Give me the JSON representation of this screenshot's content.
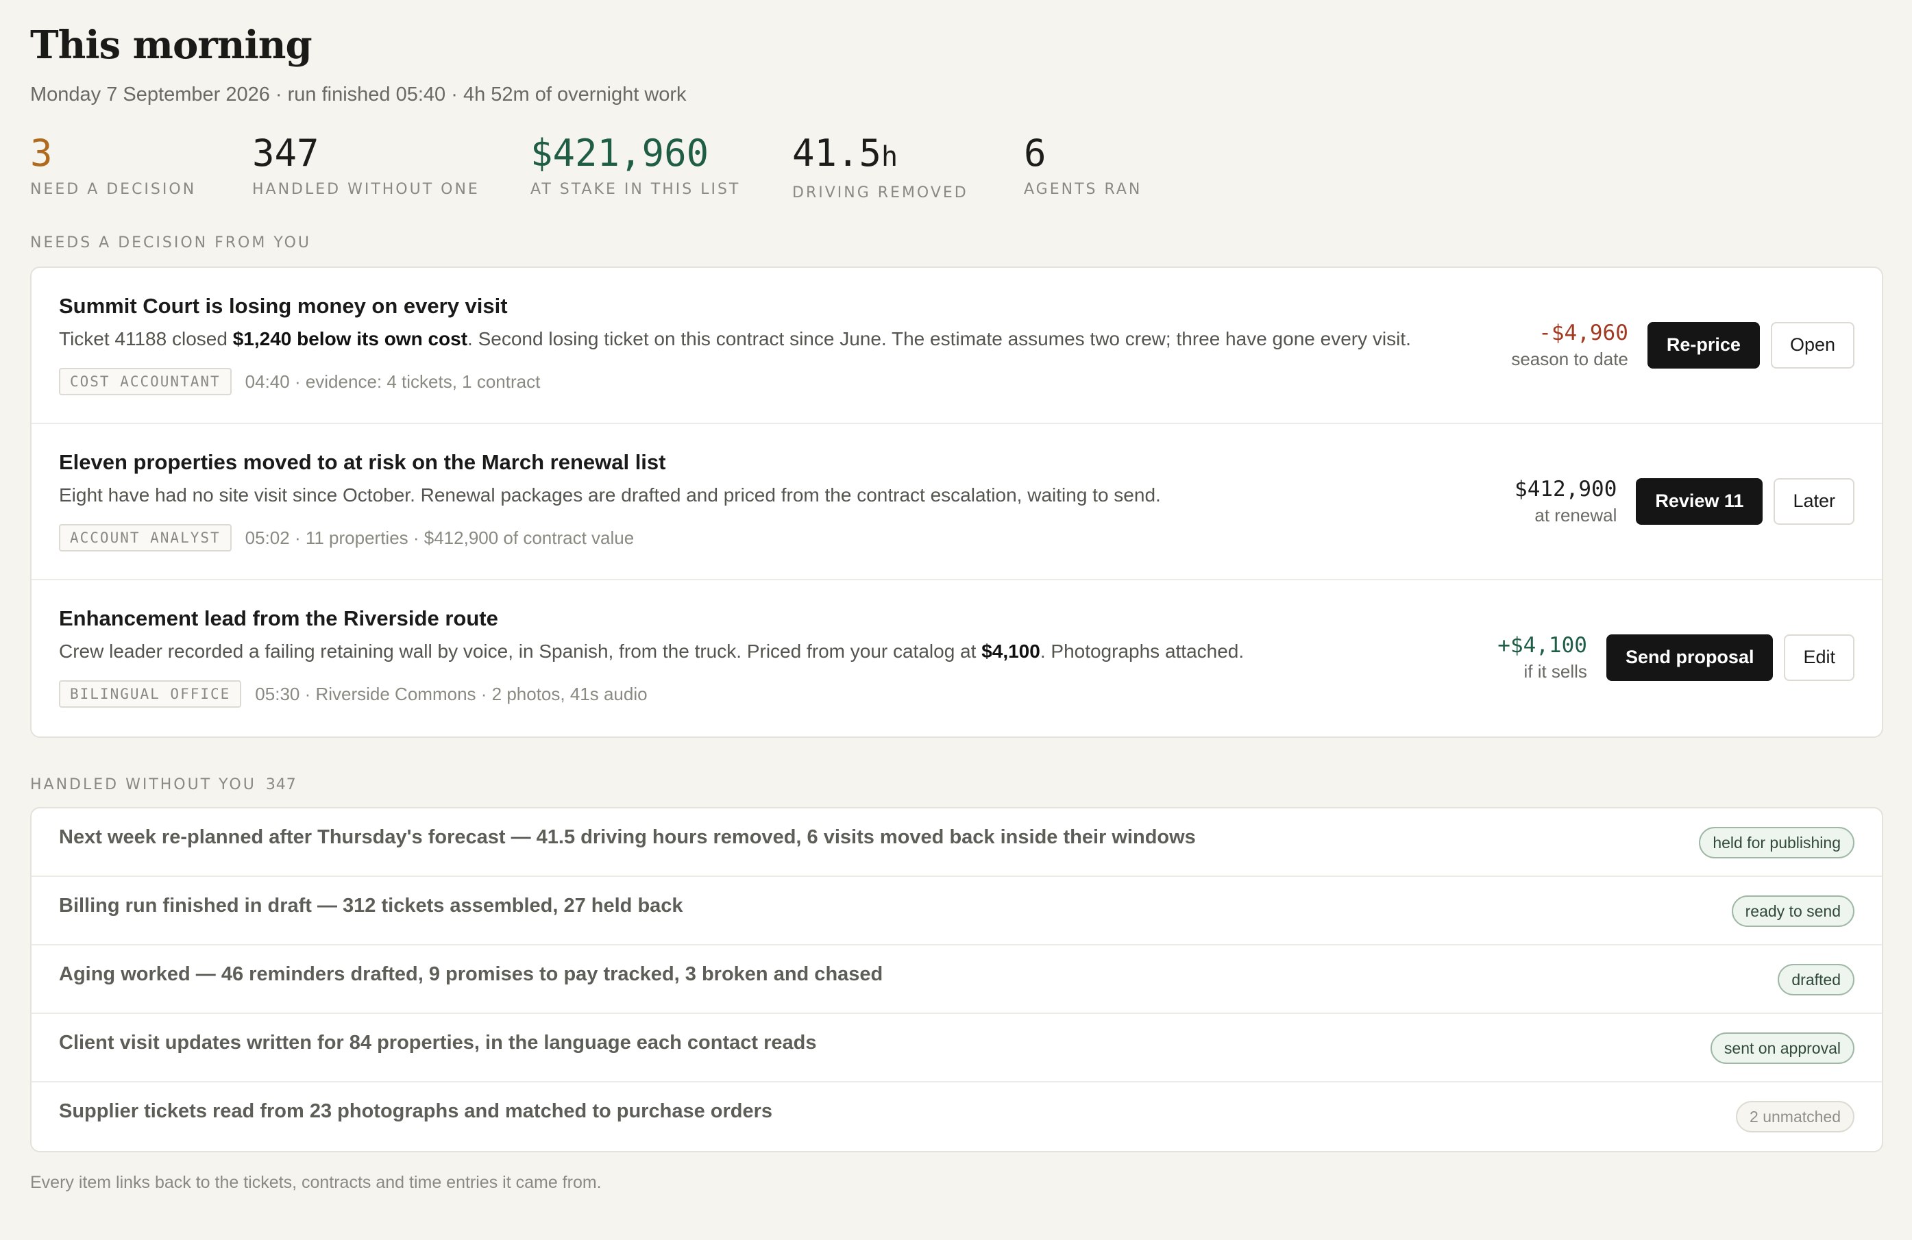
{
  "header": {
    "title": "This morning",
    "subtitle": "Monday 7 September 2026 · run finished 05:40 · 4h 52m of overnight work"
  },
  "stats": [
    {
      "value": "3",
      "unit": "",
      "label": "NEED A DECISION",
      "color": "#b06a1e"
    },
    {
      "value": "347",
      "unit": "",
      "label": "HANDLED WITHOUT ONE",
      "color": "#1c1c1a"
    },
    {
      "value": "$421,960",
      "unit": "",
      "label": "AT STAKE IN THIS LIST",
      "color": "#1f5e45"
    },
    {
      "value": "41.5",
      "unit": "h",
      "label": "DRIVING REMOVED",
      "color": "#1c1c1a"
    },
    {
      "value": "6",
      "unit": "",
      "label": "AGENTS RAN",
      "color": "#1c1c1a"
    }
  ],
  "decisions_section": {
    "label": "NEEDS A DECISION FROM YOU",
    "items": [
      {
        "title": "Summit Court is losing money on every visit",
        "body_pre": "Ticket 41188 closed ",
        "body_bold": "$1,240 below its own cost",
        "body_post": ". Second losing ticket on this contract since June. The estimate assumes two crew; three have gone every visit.",
        "tag": "COST ACCOUNTANT",
        "meta": "04:40 · evidence: 4 tickets, 1 contract",
        "amount": "-$4,960",
        "amount_note": "season to date",
        "primary_label": "Re-price",
        "secondary_label": "Open"
      },
      {
        "title": "Eleven properties moved to at risk on the March renewal list",
        "body_pre": "Eight have had no site visit since October. Renewal packages are drafted and priced from the contract escalation, waiting to send.",
        "body_bold": "",
        "body_post": "",
        "tag": "ACCOUNT ANALYST",
        "meta": "05:02 · 11 properties · $412,900 of contract value",
        "amount": "$412,900",
        "amount_note": "at renewal",
        "primary_label": "Review 11",
        "secondary_label": "Later"
      },
      {
        "title": "Enhancement lead from the Riverside route",
        "body_pre": "Crew leader recorded a failing retaining wall by voice, in Spanish, from the truck. Priced from your catalog at ",
        "body_bold": "$4,100",
        "body_post": ". Photographs attached.",
        "tag": "BILINGUAL OFFICE",
        "meta": "05:30 · Riverside Commons · 2 photos, 41s audio",
        "amount": "+$4,100",
        "amount_note": "if it sells",
        "primary_label": "Send proposal",
        "secondary_label": "Edit"
      }
    ]
  },
  "handled_section": {
    "label": "HANDLED WITHOUT YOU",
    "count": "347",
    "items": [
      {
        "text": "Next week re-planned after Thursday's forecast — 41.5 driving hours removed, 6 visits moved back inside their windows",
        "status": "held for publishing"
      },
      {
        "text": "Billing run finished in draft — 312 tickets assembled, 27 held back",
        "status": "ready to send"
      },
      {
        "text": "Aging worked — 46 reminders drafted, 9 promises to pay tracked, 3 broken and chased",
        "status": "drafted"
      },
      {
        "text": "Client visit updates written for 84 properties, in the language each contact reads",
        "status": "sent on approval"
      },
      {
        "text": "Supplier tickets read from 23 photographs and matched to purchase orders",
        "status": "2 unmatched"
      }
    ]
  },
  "footer": "Every item links back to the tickets, contracts and time entries it came from."
}
